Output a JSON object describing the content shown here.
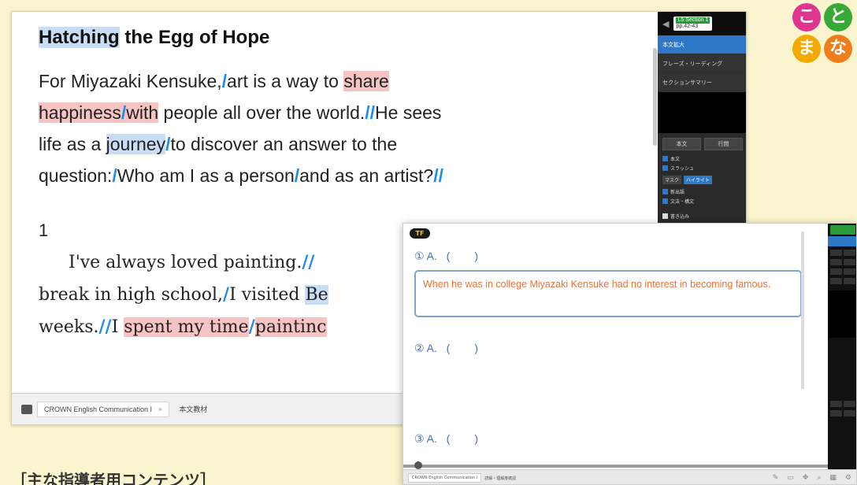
{
  "app": {
    "title": "Hatching the Egg of Hope",
    "tab_title": "CROWN English Communication I",
    "tab_close": "×",
    "tab_subtitle": "本文教材"
  },
  "text": {
    "p1_pre": "For Miyazaki Kensuke,",
    "p1_a": "art is a way to ",
    "p1_share": "share",
    "p1_happiness": "happiness",
    "p1_with": "with",
    "p1_b": " people all over the world.",
    "p1_c": "He sees",
    "p1_d": "life as a ",
    "p1_journey": "journey",
    "p1_e": "to discover an answer to the",
    "p1_f": "question:",
    "p1_g": "Who am I as a person",
    "p1_h": "and as an artist?",
    "section_num": "1",
    "p2_a": "I've always loved painting.",
    "p2_b": "break in high school,",
    "p2_c": "I visited ",
    "p2_d": "Be",
    "p2_e": "weeks.",
    "p2_f": "I ",
    "p2_g": "spent my time",
    "p2_h": "paintinc",
    "slash": "/",
    "dslash": "//"
  },
  "panel": {
    "section_badge_tag": "L5 Section 1",
    "section_badge_pages": "pp.42-43",
    "items": [
      "本文拡大",
      "フレーズ・リーディング",
      "セクションサマリー"
    ],
    "btn_left": "本文",
    "btn_right": "行間",
    "check_1": "本文",
    "check_2": "スラッシュ",
    "tab_mask": "マスク",
    "tab_highlight": "ハイライト",
    "check_3": "新出語",
    "check_4": "文法・構文",
    "check_5": "書き込み"
  },
  "overlay": {
    "badge": "TF",
    "q1": "① A.   (        )",
    "q2": "② A.   (        )",
    "q3": "③ A.   (        )",
    "answer": "When he was in college Miyazaki Kensuke had no interest in becoming famous.",
    "tab_title": "CROWN English Communication I",
    "tab_subtitle": "読解・理解度確認"
  },
  "logo": [
    "こ",
    "と",
    "ま",
    "な"
  ],
  "caption": "［主な指導者用コンテンツ］",
  "colors": {
    "background": "#fbf5cf",
    "accent_blue": "#2f78c7",
    "slash_blue": "#1e8ce8",
    "highlight_pink": "#f7c4c4",
    "highlight_blue": "#c9def5",
    "answer_orange": "#e8733a",
    "logo_pink": "#e0358f",
    "logo_green": "#39a935",
    "logo_yellow": "#f2a900",
    "logo_orange": "#ee7d1c"
  }
}
